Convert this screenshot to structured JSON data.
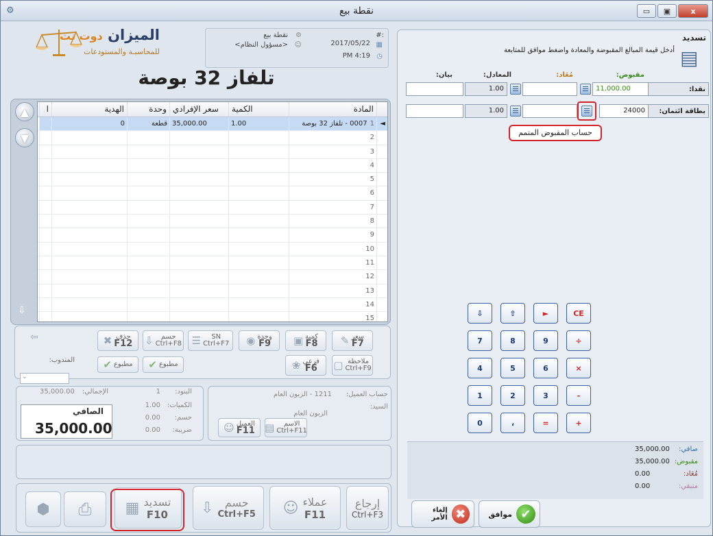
{
  "window": {
    "title": "نقطة بيع",
    "minimize": "▭",
    "maximize": "▣",
    "close": "x"
  },
  "brand": {
    "name": "الميزان",
    "name_suffix": "دوت نت",
    "subtitle": "للمحاسبـة والمستودعات"
  },
  "info": {
    "hash": ":#",
    "date": "2017/05/22",
    "time": "PM 4:19",
    "pos_label": "نقطة بيع",
    "user": "<مسؤول النظام>"
  },
  "product_title": "تلفاز 32 بوصة",
  "grid": {
    "headers": {
      "item": "المادة",
      "qty": "الكمية",
      "price": "سعر الإفرادي",
      "unit": "وحدة",
      "gift": "الهدية"
    },
    "rows": [
      {
        "n": "1",
        "item": "0007 - تلفاز 32 بوصة",
        "qty": "1.00",
        "price": "35,000.00",
        "unit": "قطعة",
        "gift": "0"
      },
      {
        "n": "2"
      },
      {
        "n": "3"
      },
      {
        "n": "4"
      },
      {
        "n": "5"
      },
      {
        "n": "6"
      },
      {
        "n": "7"
      },
      {
        "n": "8"
      },
      {
        "n": "9"
      },
      {
        "n": "10"
      },
      {
        "n": "11"
      },
      {
        "n": "12"
      },
      {
        "n": "13"
      },
      {
        "n": "14"
      },
      {
        "n": "15"
      }
    ]
  },
  "toolbar": {
    "price": "سعر",
    "price_key": "F7",
    "qty": "كمية",
    "qty_key": "F8",
    "unit": "وحدة",
    "unit_key": "F9",
    "sn": "SN",
    "sn_key": "Ctrl+F7",
    "discount": "حسم",
    "discount_key": "Ctrl+F8",
    "delete": "حذف",
    "delete_key": "F12",
    "note": "ملاحظة",
    "note_key": "Ctrl+F9",
    "sub": "فرعي",
    "sub_key": "F6",
    "printed1": "مطبوع",
    "printed2": "مطبوع",
    "rep_label": "المندوب:"
  },
  "stats": {
    "total_label": "الإجمالي:",
    "total": "35,000.00",
    "items_label": "البنود:",
    "items": "1",
    "qty_label": "الكميات:",
    "qty": "1.00",
    "disc_label": "حسم:",
    "disc": "0.00",
    "tax_label": "ضريبة:",
    "tax": "0.00",
    "net_label": "الصافي",
    "net": "35,000.00"
  },
  "customer": {
    "account_label": "حساب العميل:",
    "account": "1211 - الزبون العام",
    "mr_label": "السيد:",
    "mr_value": "الزبون العام",
    "client": "العميل",
    "client_key": "F11",
    "name": "الاسم",
    "name_key": "Ctrl+F11"
  },
  "bottom": {
    "return": "إرجاع",
    "return_key": "Ctrl+F3",
    "customers": "عملاء",
    "customers_key": "F11",
    "discount": "حسم",
    "discount_key": "Ctrl+F5",
    "pay": "تسديد",
    "pay_key": "F10"
  },
  "payment": {
    "title": "تسديد",
    "instruction": "أدخل قيمة المبالغ المقبوضة والمعادة واضغط موافق للمتابعة",
    "col_received": "مقبوض:",
    "col_returned": "مُعَاد:",
    "col_rate": "المعادل:",
    "col_note": "بيان:",
    "cash_label": "نقدا:",
    "cash_value": "11,000.00",
    "cash_rate": "1.00",
    "card_label": "بطاقة ائتمان:",
    "card_value": "24000",
    "card_rate": "1.00",
    "tooltip": "حساب المقبوض المتمم"
  },
  "keypad": [
    "CE",
    "►",
    "⇧",
    "⇩",
    "÷",
    "9",
    "8",
    "7",
    "×",
    "6",
    "5",
    "4",
    "-",
    "3",
    "2",
    "1",
    "+",
    "=",
    "،",
    "0"
  ],
  "totals": {
    "net_label": "صافي:",
    "net": "35,000.00",
    "received_label": "مقبوض:",
    "received": "35,000.00",
    "returned_label": "مُعَاد:",
    "returned": "0.00",
    "remaining_label": "متبقي:",
    "remaining": "0.00"
  },
  "actions": {
    "ok": "موافق",
    "cancel": "إلغاء الأمر"
  },
  "colors": {
    "accent": "#2b3e67",
    "red": "#d2222a",
    "green": "#3a8a1e",
    "gold": "#e0831b"
  }
}
